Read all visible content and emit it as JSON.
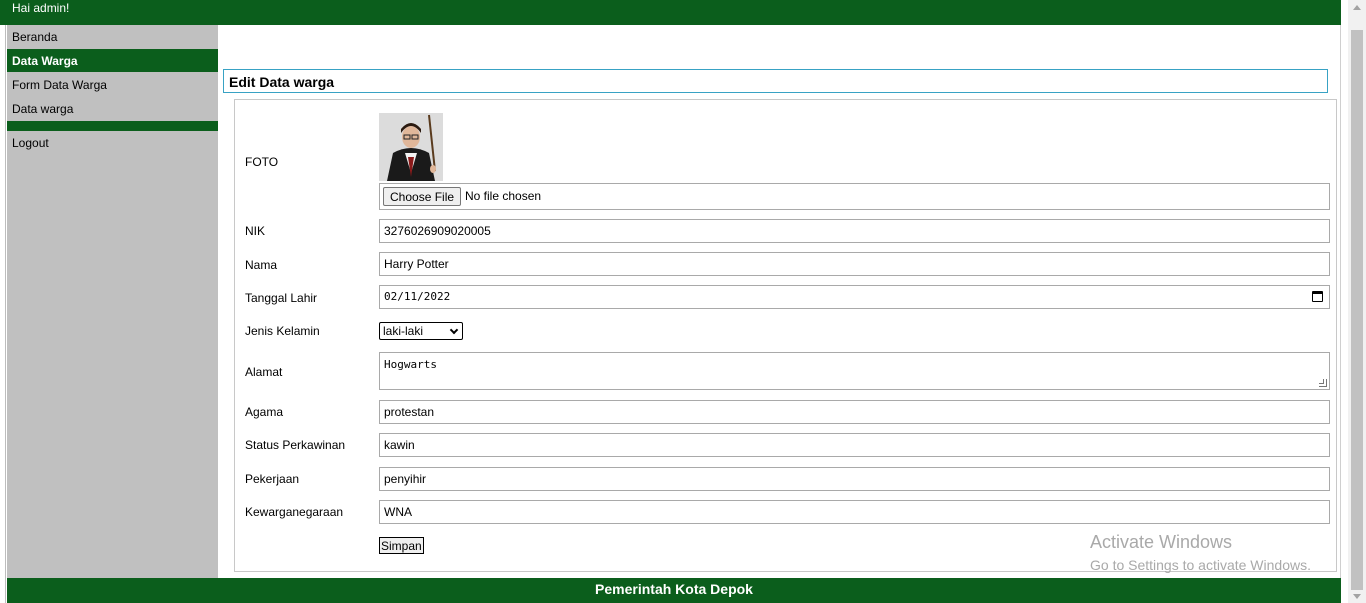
{
  "header": {
    "greeting": "Hai admin!"
  },
  "sidebar": {
    "items": [
      {
        "label": "Beranda"
      },
      {
        "label": "Data Warga"
      },
      {
        "label": "Form Data Warga"
      },
      {
        "label": "Data warga"
      },
      {
        "label": "Logout"
      }
    ]
  },
  "main": {
    "title": "Edit Data warga",
    "form": {
      "foto_label": "FOTO",
      "file_button": "Choose File",
      "file_status": "No file chosen",
      "fields": {
        "nik": {
          "label": "NIK",
          "value": "3276026909020005"
        },
        "nama": {
          "label": "Nama",
          "value": "Harry Potter"
        },
        "tanggal_lahir": {
          "label": "Tanggal Lahir",
          "value": "02/11/2022"
        },
        "jenis_kelamin": {
          "label": "Jenis Kelamin",
          "value": "laki-laki"
        },
        "alamat": {
          "label": "Alamat",
          "value": "Hogwarts"
        },
        "agama": {
          "label": "Agama",
          "value": "protestan"
        },
        "status_perkawinan": {
          "label": "Status Perkawinan",
          "value": "kawin"
        },
        "pekerjaan": {
          "label": "Pekerjaan",
          "value": "penyihir"
        },
        "kewarganegaraan": {
          "label": "Kewarganegaraan",
          "value": "WNA"
        }
      },
      "submit_label": "Simpan"
    }
  },
  "watermark": {
    "line1": "Activate Windows",
    "line2": "Go to Settings to activate Windows."
  },
  "footer": {
    "text": "Pemerintah Kota Depok"
  },
  "colors": {
    "brand_green": "#0b5e1c",
    "sidebar_gray": "#c0c0c0",
    "title_border": "#38a2c4"
  }
}
